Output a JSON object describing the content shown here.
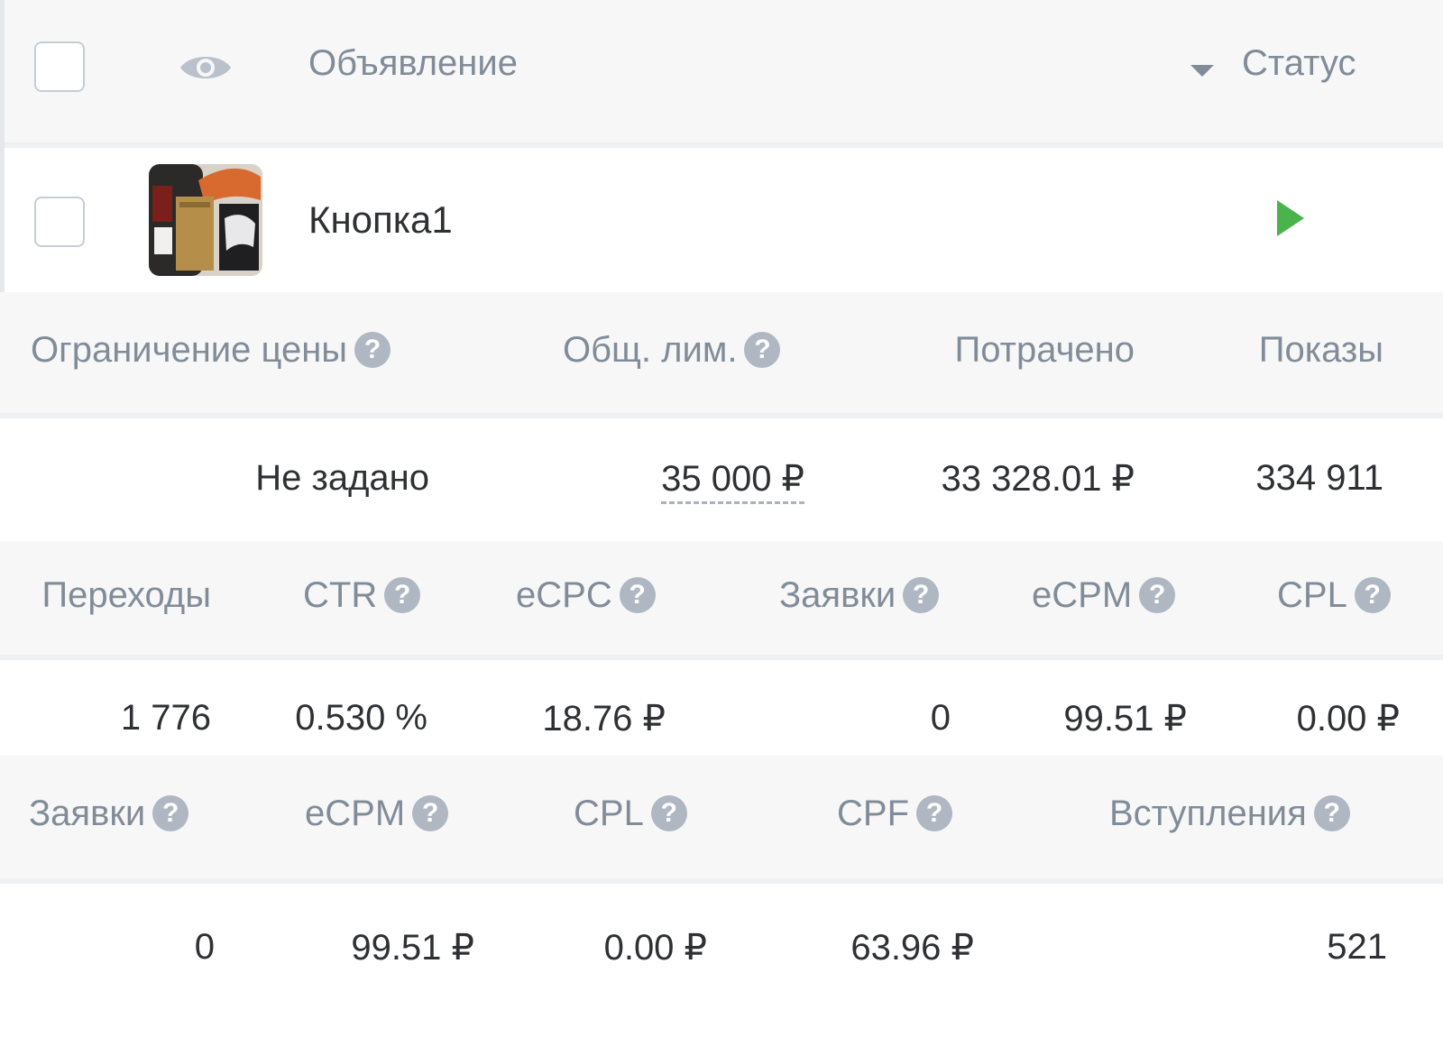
{
  "header": {
    "ad_label": "Объявление",
    "status_label": "Статус"
  },
  "ad": {
    "name": "Кнопка1",
    "status_color": "#4bb34b"
  },
  "section1": {
    "headers": {
      "price_limit": "Ограничение цены",
      "total_limit": "Общ. лим.",
      "spent": "Потрачено",
      "impressions": "Показы"
    },
    "values": {
      "price_limit": "Не задано",
      "total_limit": "35 000 ₽",
      "spent": "33 328.01 ₽",
      "impressions": "334 911"
    }
  },
  "section2": {
    "headers": {
      "clicks": "Переходы",
      "ctr": "CTR",
      "ecpc": "eCPC",
      "leads": "Заявки",
      "ecpm": "eCPM",
      "cpl": "CPL"
    },
    "values": {
      "clicks": "1 776",
      "ctr": "0.530 %",
      "ecpc": "18.76 ₽",
      "leads": "0",
      "ecpm": "99.51 ₽",
      "cpl": "0.00 ₽"
    }
  },
  "section3": {
    "headers": {
      "leads": "Заявки",
      "ecpm": "eCPM",
      "cpl": "CPL",
      "cpf": "CPF",
      "joins": "Вступления"
    },
    "values": {
      "leads": "0",
      "ecpm": "99.51 ₽",
      "cpl": "0.00 ₽",
      "cpf": "63.96 ₽",
      "joins": "521"
    }
  },
  "help_glyph": "?"
}
